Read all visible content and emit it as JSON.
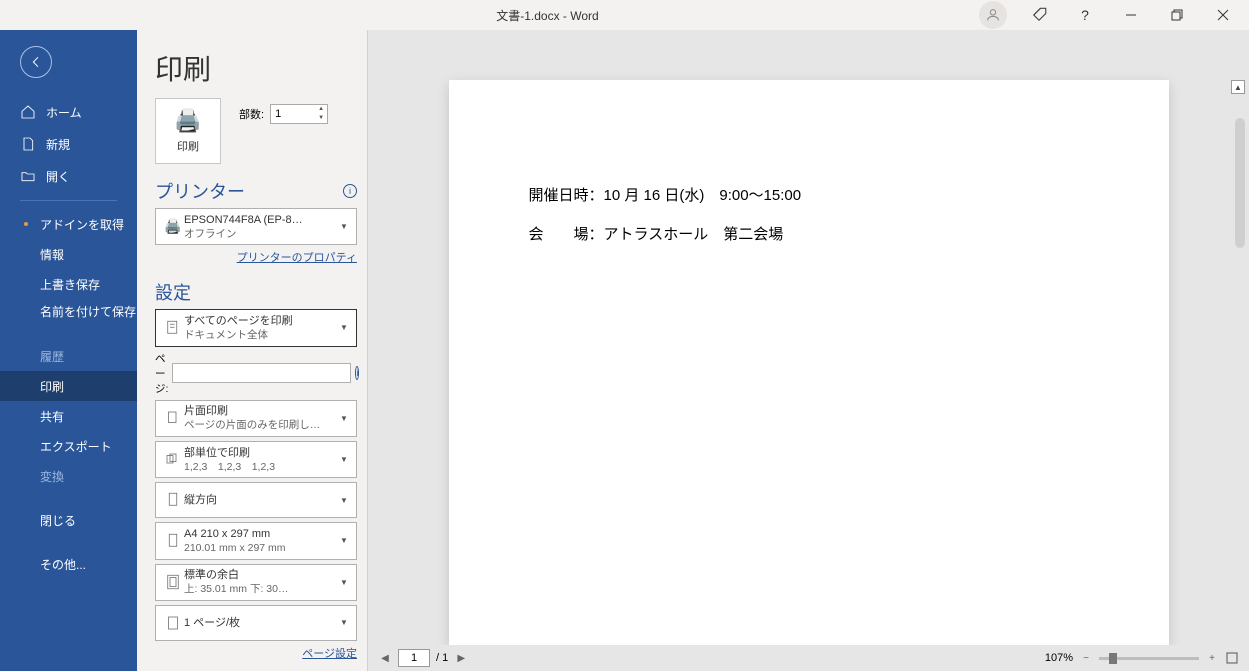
{
  "titlebar": {
    "title": "文書-1.docx  -  Word"
  },
  "sidebar": {
    "home": "ホーム",
    "new": "新規",
    "open": "開く",
    "addins": "アドインを取得",
    "info": "情報",
    "save": "上書き保存",
    "saveas": "名前を付けて保存",
    "history": "履歴",
    "print": "印刷",
    "share": "共有",
    "export": "エクスポート",
    "transform": "変換",
    "close": "閉じる",
    "more": "その他..."
  },
  "panel": {
    "title": "印刷",
    "print_button": "印刷",
    "copies_label": "部数:",
    "copies_value": "1",
    "printer_heading": "プリンター",
    "printer_name": "EPSON744F8A (EP-8…",
    "printer_status": "オフライン",
    "printer_props": "プリンターのプロパティ",
    "settings_heading": "設定",
    "page_range_l1": "すべてのページを印刷",
    "page_range_l2": "ドキュメント全体",
    "pages_label": "ページ:",
    "sides_l1": "片面印刷",
    "sides_l2": "ページの片面のみを印刷し…",
    "collate_l1": "部単位で印刷",
    "collate_l2": "1,2,3　1,2,3　1,2,3",
    "orient_l1": "縦方向",
    "size_l1": "A4 210 x 297 mm",
    "size_l2": "210.01 mm x 297 mm",
    "margin_l1": "標準の余白",
    "margin_l2": "上: 35.01 mm 下: 30…",
    "perpage_l1": "1 ページ/枚",
    "page_setup": "ページ設定"
  },
  "preview": {
    "line1": "開催日時：10 月 16 日(水)　9:00～15:00",
    "line2": "会　　場：アトラスホール　第二会場",
    "page_current": "1",
    "page_total": "/ 1",
    "zoom": "107%"
  }
}
